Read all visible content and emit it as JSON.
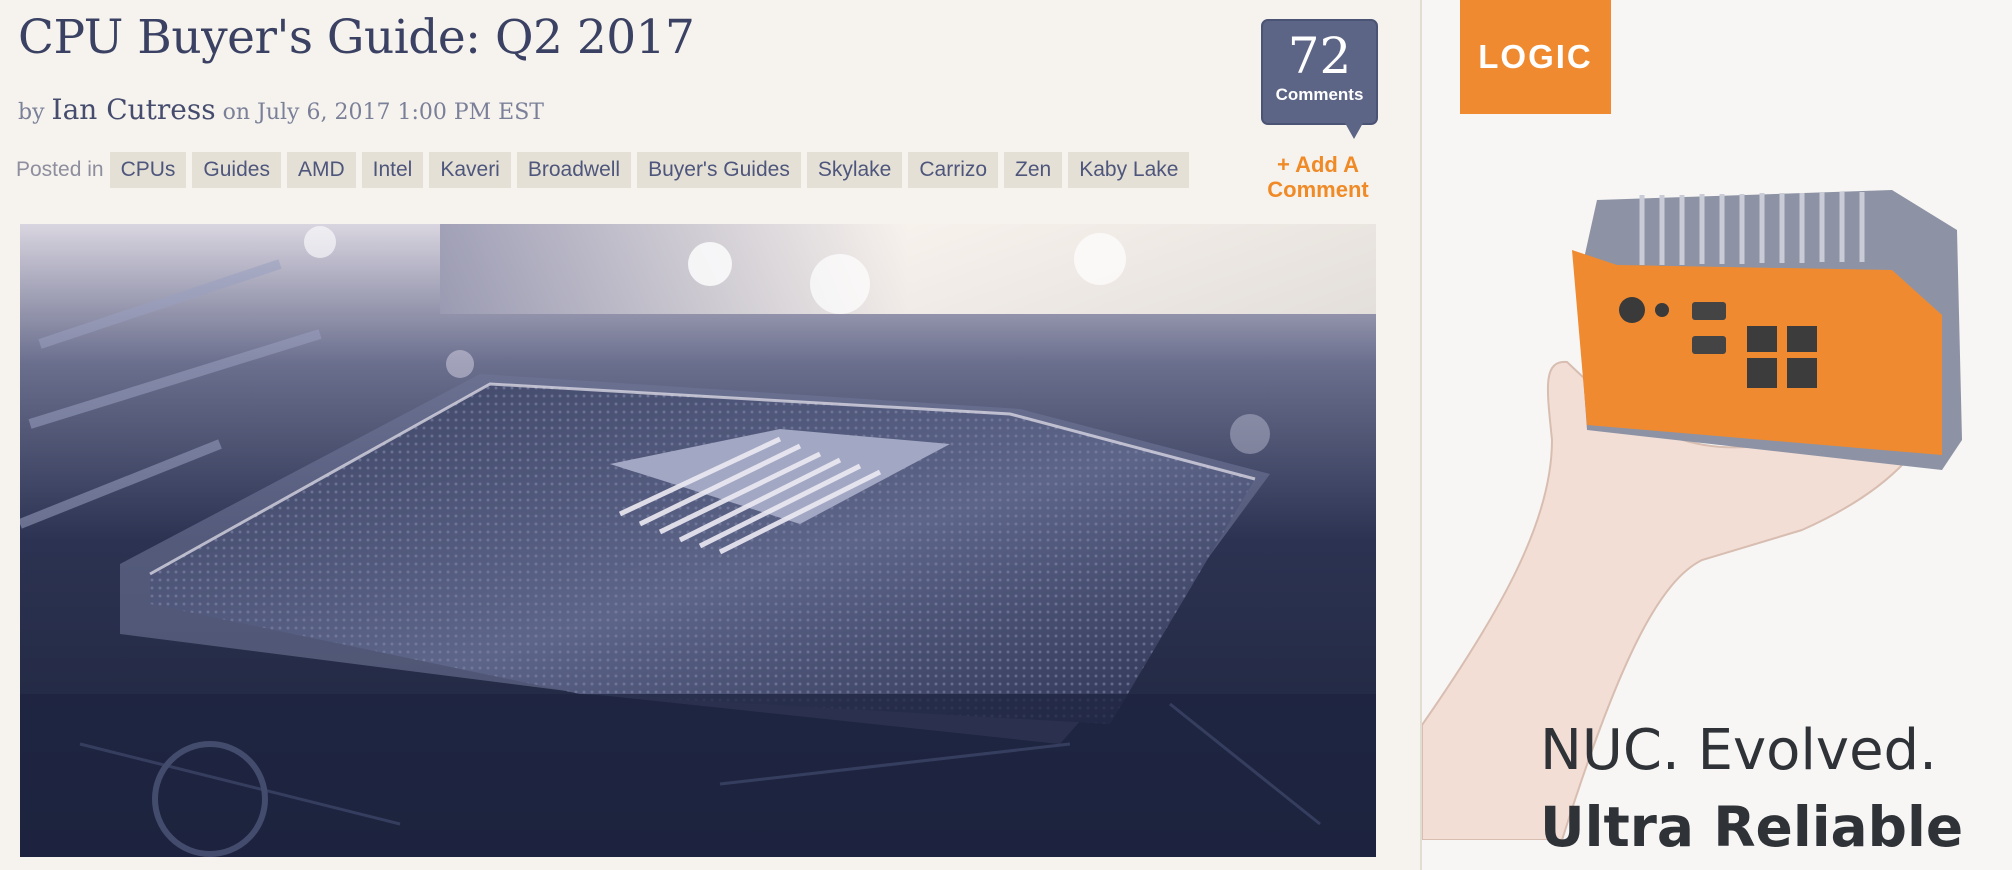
{
  "article": {
    "title": "CPU Buyer's Guide: Q2 2017",
    "byline": {
      "prefix": "by",
      "author": "Ian Cutress",
      "date_prefix": "on",
      "date": "July 6, 2017 1:00 PM EST"
    },
    "posted_in_label": "Posted in",
    "tags": [
      "CPUs",
      "Guides",
      "AMD",
      "Intel",
      "Kaveri",
      "Broadwell",
      "Buyer's Guides",
      "Skylake",
      "Carrizo",
      "Zen",
      "Kaby Lake"
    ],
    "comments": {
      "count": "72",
      "label": "Comments",
      "add_label": "+ Add A Comment"
    }
  },
  "ad": {
    "brand": "LOGIC",
    "line1": "NUC. Evolved.",
    "line2": "Ultra Reliable"
  },
  "colors": {
    "page_bg": "#f6f3ee",
    "title": "#3a4163",
    "tag_bg": "#e5e0d6",
    "tag_text": "#4e567c",
    "accent_orange": "#f08a27",
    "comment_bubble": "#5c6585"
  }
}
